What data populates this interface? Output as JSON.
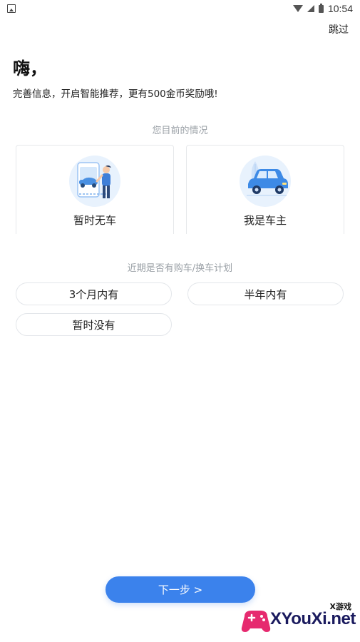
{
  "status_bar": {
    "time": "10:54"
  },
  "header": {
    "skip_label": "跳过"
  },
  "intro": {
    "greeting": "嗨，",
    "subtitle": "完善信息，开启智能推荐，更有500金币奖励哦!"
  },
  "situation": {
    "label": "您目前的情况",
    "options": [
      {
        "label": "暂时无车",
        "icon": "person-with-car-icon"
      },
      {
        "label": "我是车主",
        "icon": "blue-car-icon"
      }
    ]
  },
  "plan": {
    "label": "近期是否有购车/换车计划",
    "options": [
      {
        "label": "3个月内有"
      },
      {
        "label": "半年内有"
      },
      {
        "label": "暂时没有"
      }
    ]
  },
  "footer": {
    "next_label": "下一步 >"
  },
  "watermark": {
    "small_text": "X游戏",
    "brand": "XYouXi.net"
  },
  "colors": {
    "accent": "#3b82ec",
    "label_gray": "#9aa0a6",
    "border": "#e3e6ea"
  }
}
